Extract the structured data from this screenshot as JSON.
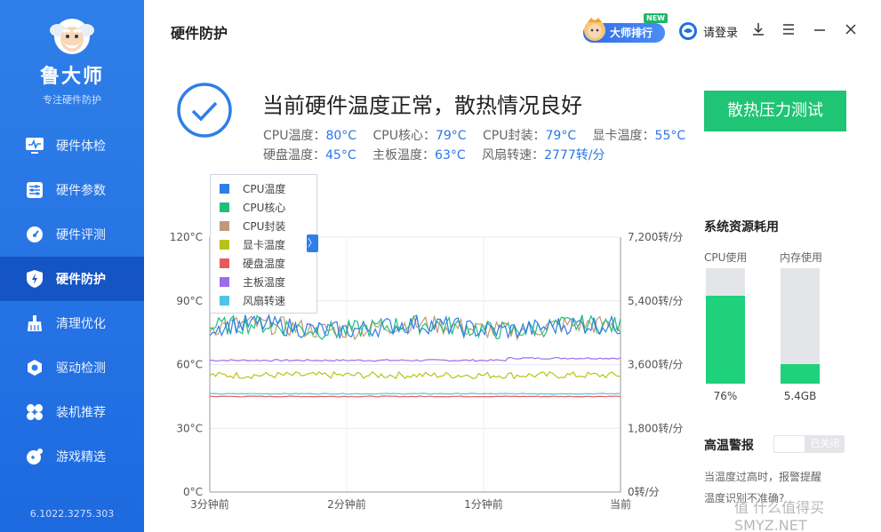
{
  "app": {
    "brand": "鲁大师",
    "slogan": "专注硬件防护",
    "version": "6.1022.3275.303"
  },
  "sidebar": {
    "items": [
      {
        "label": "硬件体检",
        "icon": "monitor-pulse-icon",
        "active": false
      },
      {
        "label": "硬件参数",
        "icon": "sliders-icon",
        "active": false
      },
      {
        "label": "硬件评测",
        "icon": "speedometer-icon",
        "active": false
      },
      {
        "label": "硬件防护",
        "icon": "shield-bolt-icon",
        "active": true
      },
      {
        "label": "清理优化",
        "icon": "broom-icon",
        "active": false
      },
      {
        "label": "驱动检测",
        "icon": "hexagon-gear-icon",
        "active": false
      },
      {
        "label": "装机推荐",
        "icon": "fan-icon",
        "active": false
      },
      {
        "label": "游戏精选",
        "icon": "gamepad-icon",
        "active": false
      }
    ]
  },
  "header": {
    "title": "硬件防护",
    "rank_label": "大师排行",
    "new_badge": "NEW",
    "login_label": "请登录"
  },
  "status": {
    "title": "当前硬件温度正常，散热情况良好",
    "row1": [
      {
        "label": "CPU温度：",
        "value": "80°C"
      },
      {
        "label": "CPU核心：",
        "value": "79°C"
      },
      {
        "label": "CPU封装：",
        "value": "79°C"
      },
      {
        "label": "显卡温度：",
        "value": "55°C"
      }
    ],
    "row2": [
      {
        "label": "硬盘温度：",
        "value": "45°C"
      },
      {
        "label": "主板温度：",
        "value": "63°C"
      },
      {
        "label": "风扇转速：",
        "value": "2777转/分"
      }
    ],
    "stress_button": "散热压力测试"
  },
  "chart_data": {
    "type": "line",
    "y_left_ticks": [
      "120°C",
      "90°C",
      "60°C",
      "30°C",
      "0°C"
    ],
    "y_right_ticks": [
      "7,200转/分",
      "5,400转/分",
      "3,600转/分",
      "1,800转/分",
      "0转/分"
    ],
    "x_ticks": [
      "3分钟前",
      "2分钟前",
      "1分钟前",
      "当前"
    ],
    "ylim_temp": [
      0,
      120
    ],
    "ylim_fan": [
      0,
      7200
    ],
    "grid": true,
    "legend_placement": "top-left",
    "legend_toggle": "〉",
    "series": [
      {
        "name": "CPU温度",
        "color": "#2f7fe8",
        "approx_level": 80
      },
      {
        "name": "CPU核心",
        "color": "#1fbf7a",
        "approx_level": 79
      },
      {
        "name": "CPU封装",
        "color": "#c09a7a",
        "approx_level": 79
      },
      {
        "name": "显卡温度",
        "color": "#b8c21a",
        "approx_level": 55
      },
      {
        "name": "硬盘温度",
        "color": "#e85a5a",
        "approx_level": 45
      },
      {
        "name": "主板温度",
        "color": "#9a6ee8",
        "approx_level": 62
      },
      {
        "name": "风扇转速",
        "color": "#4fc6e8",
        "approx_level": 2777
      }
    ]
  },
  "resources": {
    "title": "系统资源耗用",
    "cpu": {
      "label": "CPU使用",
      "value": "76%",
      "fraction": 0.76
    },
    "memory": {
      "label": "内存使用",
      "value": "5.4GB",
      "fraction": 0.17
    }
  },
  "alert": {
    "title": "高温警报",
    "state": "已关闭",
    "desc_line1": "当温度过高时，报警提醒",
    "desc_line2": "温度识别不准确?"
  },
  "watermark": "值 什么值得买 SMYZ.NET"
}
